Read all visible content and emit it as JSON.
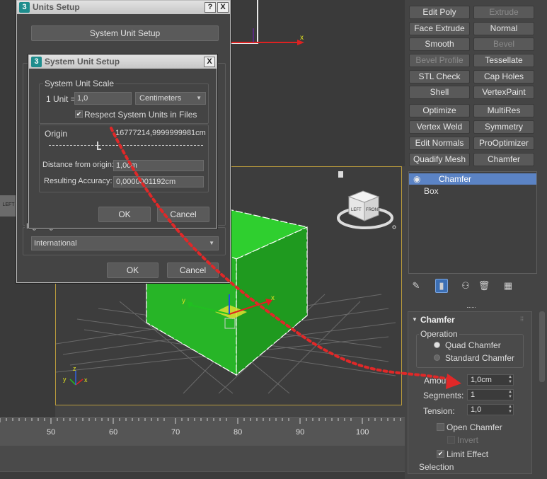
{
  "modifier_buttons": [
    {
      "label": "Edit Poly",
      "disabled": false
    },
    {
      "label": "Extrude",
      "disabled": true
    },
    {
      "label": "Face Extrude",
      "disabled": false
    },
    {
      "label": "Normal",
      "disabled": false
    },
    {
      "label": "Smooth",
      "disabled": false
    },
    {
      "label": "Bevel",
      "disabled": true
    },
    {
      "label": "Bevel Profile",
      "disabled": true
    },
    {
      "label": "Tessellate",
      "disabled": false
    },
    {
      "label": "STL Check",
      "disabled": false
    },
    {
      "label": "Cap Holes",
      "disabled": false
    },
    {
      "label": "Shell",
      "disabled": false
    },
    {
      "label": "VertexPaint",
      "disabled": false
    },
    {
      "label": "Optimize",
      "disabled": false
    },
    {
      "label": "MultiRes",
      "disabled": false
    },
    {
      "label": "Vertex Weld",
      "disabled": false
    },
    {
      "label": "Symmetry",
      "disabled": false
    },
    {
      "label": "Edit Normals",
      "disabled": false
    },
    {
      "label": "ProOptimizer",
      "disabled": false
    },
    {
      "label": "Quadify Mesh",
      "disabled": false
    },
    {
      "label": "Chamfer",
      "disabled": false
    }
  ],
  "modifier_stack": [
    {
      "label": "Chamfer",
      "selected": true
    },
    {
      "label": "Box",
      "selected": false
    }
  ],
  "chamfer_rollout": {
    "title": "Chamfer",
    "operation_label": "Operation",
    "quad_chamfer": "Quad Chamfer",
    "standard_chamfer": "Standard Chamfer",
    "selected_operation": "Quad Chamfer",
    "amount_label": "Amount:",
    "amount_value": "1,0cm",
    "segments_label": "Segments:",
    "segments_value": "1",
    "tension_label": "Tension:",
    "tension_value": "1,0",
    "open_chamfer": "Open Chamfer",
    "invert": "Invert",
    "limit_effect": "Limit Effect",
    "selection_label": "Selection",
    "open_chamfer_checked": false,
    "invert_checked": false,
    "limit_effect_checked": true
  },
  "units_setup": {
    "title": "Units Setup",
    "help_button": "?",
    "close_button": "X",
    "system_unit_setup_button": "System Unit Setup",
    "lighting_units_label": "Lighting Units",
    "lighting_units_value": "International",
    "ok": "OK",
    "cancel": "Cancel"
  },
  "system_unit_setup": {
    "title": "System Unit Setup",
    "close_button": "X",
    "scale_group_label": "System Unit Scale",
    "unit_label": "1 Unit =",
    "unit_value": "1,0",
    "unit_type": "Centimeters",
    "respect_label": "Respect System Units in Files",
    "respect_checked": true,
    "origin_label": "Origin",
    "origin_value": "16777214,9999999981cm",
    "distance_label": "Distance from origin:",
    "distance_value": "1,0cm",
    "accuracy_label": "Resulting Accuracy:",
    "accuracy_value": "0,0000001192cm",
    "ok": "OK",
    "cancel": "Cancel"
  },
  "viewport": {
    "gizmo_x": "x",
    "gizmo_y": "y",
    "axis_x": "x",
    "axis_y": "y",
    "axis_z": "z",
    "top_view_axis_x": "x",
    "viewcube_front": "LEFT",
    "viewcube_right": "FRONT",
    "left_mini_label": "LEFT",
    "box_color": "#26b326"
  },
  "timeline": {
    "ticks": [
      "50",
      "60",
      "70",
      "80",
      "90",
      "100"
    ]
  },
  "colors": {
    "selection_blue": "#5b83c4",
    "annotation_red": "#e02828",
    "viewport_border": "#b89a3c"
  }
}
